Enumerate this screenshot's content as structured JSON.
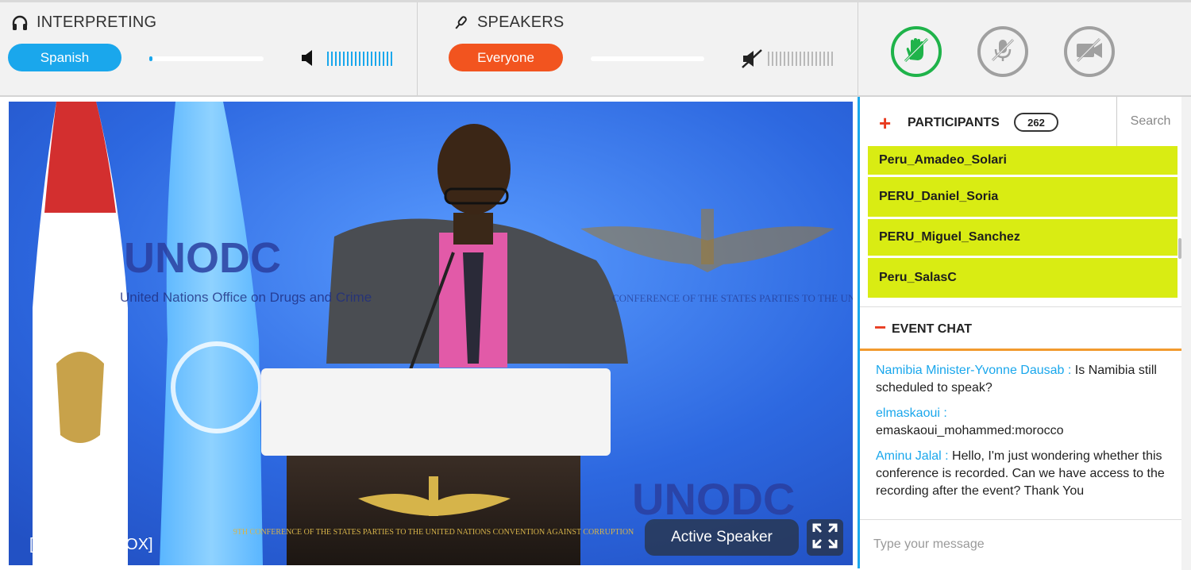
{
  "interpreting": {
    "title": "INTERPRETING",
    "language": "Spanish",
    "slider_level": 0.03,
    "volume_level": 1.0
  },
  "speakers": {
    "title": "SPEAKERS",
    "target": "Everyone",
    "slider_level": 0.0,
    "volume_level": 0.0,
    "muted": true
  },
  "controls": {
    "raise_hand": "raise-hand-icon",
    "mic": "mic-muted-icon",
    "camera": "camera-off-icon"
  },
  "video": {
    "room_label": "[Plenary UNBOX]",
    "active_speaker_label": "Active Speaker",
    "backdrop_text": "UNODC",
    "backdrop_subtext": "United Nations Office on Drugs and Crime",
    "podium_event": "9TH CONFERENCE OF THE STATES PARTIES TO THE UNITED NATIONS CONVENTION AGAINST CORRUPTION",
    "banner_text": "CONFERENCE OF THE STATES PARTIES TO THE UNITED NATIONS CONVENTION AGAINST CORRUPTION"
  },
  "participants": {
    "title": "PARTICIPANTS",
    "count": "262",
    "search_placeholder": "Search",
    "items": [
      {
        "name": "Peru_Amadeo_Solari"
      },
      {
        "name": "PERU_Daniel_Soria"
      },
      {
        "name": "PERU_Miguel_Sanchez"
      },
      {
        "name": "Peru_SalasC"
      }
    ]
  },
  "chat": {
    "title": "EVENT CHAT",
    "messages": [
      {
        "author": "Namibia Minister-Yvonne Dausab :",
        "text": "Is Namibia still scheduled to speak?"
      },
      {
        "author": "elmaskaoui :",
        "text": "emaskaoui_mohammed:morocco"
      },
      {
        "author": "Aminu Jalal :",
        "text": "Hello, I'm just wondering whether this conference is recorded. Can we have access to the recording after the event? Thank You"
      }
    ],
    "input_placeholder": "Type your message"
  },
  "colors": {
    "accent_blue": "#1aa7ec",
    "accent_orange": "#f2541f",
    "participant_highlight": "#d9ec13",
    "hand_green": "#1fb34a"
  }
}
